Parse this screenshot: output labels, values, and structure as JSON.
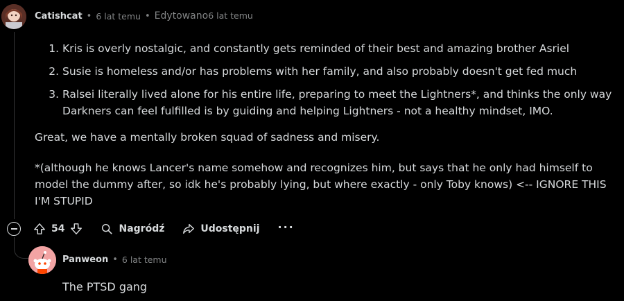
{
  "comment": {
    "author": "Catishcat",
    "time": "6 lat temu",
    "edited_label": "Edytowano",
    "edited_time": "6 lat temu",
    "list": [
      "Kris is overly nostalgic, and constantly gets reminded of their best and amazing brother Asriel",
      "Susie is homeless and/or has problems with her family, and also probably doesn't get fed much",
      "Ralsei literally lived alone for his entire life, preparing to meet the Lightners*, and thinks the only way Darkners can feel fulfilled is by guiding and helping Lightners - not a healthy mindset, IMO."
    ],
    "para1": "Great, we have a mentally broken squad of sadness and misery.",
    "para2": "*(although he knows Lancer's name somehow and recognizes him, but says that he only had himself to model the dummy after, so idk he's probably lying, but where exactly - only Toby knows) <-- IGNORE THIS I'M STUPID",
    "score": "54",
    "award_label": "Nagródź",
    "share_label": "Udostępnij",
    "more_label": "···"
  },
  "reply": {
    "author": "Panweon",
    "time": "6 lat temu",
    "text": "The PTSD gang"
  }
}
